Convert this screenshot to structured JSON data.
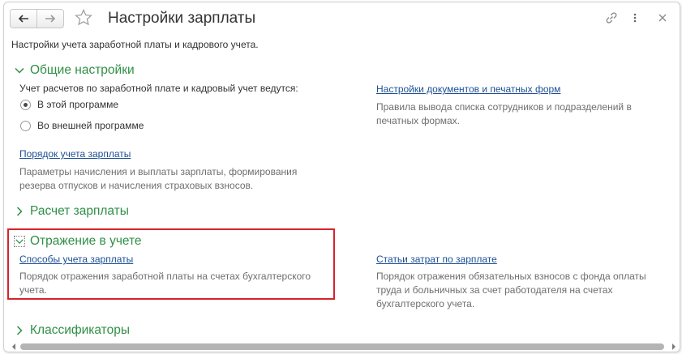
{
  "window": {
    "title": "Настройки зарплаты",
    "subtitle": "Настройки учета заработной платы и кадрового учета."
  },
  "toolbar": {
    "back_icon": "arrow-left-icon",
    "forward_icon": "arrow-right-icon",
    "favorite_icon": "star-icon",
    "link_icon": "link-icon",
    "more_icon": "more-vertical-icon",
    "close_icon": "close-icon"
  },
  "sections": {
    "general": {
      "title": "Общие настройки",
      "expanded": true,
      "question": "Учет расчетов по заработной плате и кадровый учет ведутся:",
      "options": [
        {
          "label": "В этой программе",
          "selected": true
        },
        {
          "label": "Во внешней программе",
          "selected": false
        }
      ],
      "payroll_order_link": "Порядок учета зарплаты",
      "payroll_order_desc": "Параметры начисления и выплаты зарплаты, формирования резерва отпусков и начисления страховых взносов.",
      "docs_settings_link": "Настройки документов и печатных форм",
      "docs_settings_desc": "Правила вывода списка сотрудников и подразделений в печатных формах."
    },
    "calculation": {
      "title": "Расчет зарплаты",
      "expanded": false
    },
    "accounting": {
      "title": "Отражение в учете",
      "expanded": true,
      "methods_link": "Способы учета зарплаты",
      "methods_desc": "Порядок отражения заработной платы на счетах бухгалтерского учета.",
      "cost_items_link": "Статьи затрат по зарплате",
      "cost_items_desc": "Порядок отражения обязательных взносов с фонда оплаты труда и больничных за счет работодателя на счетах бухгалтерского учета."
    },
    "classifiers": {
      "title": "Классификаторы",
      "expanded": false
    }
  },
  "colors": {
    "section_title": "#2f8f46",
    "link": "#1d4f94",
    "highlight_border": "#d6232a"
  }
}
